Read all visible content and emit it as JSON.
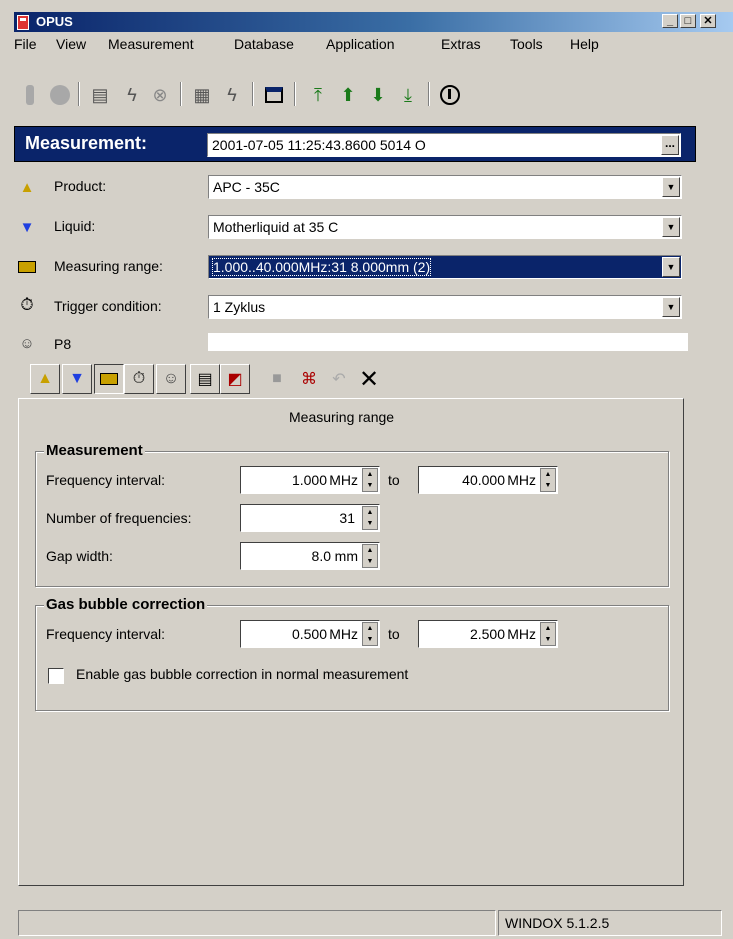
{
  "window": {
    "title": "OPUS"
  },
  "menu": [
    "File",
    "View",
    "Measurement",
    "Database",
    "Application",
    "Extras",
    "Tools",
    "Help"
  ],
  "measurement": {
    "label": "Measurement:",
    "value": "2001-07-05 11:25:43.8600 5014 O",
    "browse_label": "..."
  },
  "properties": {
    "product": {
      "label": "Product:",
      "value": "APC - 35C"
    },
    "liquid": {
      "label": "Liquid:",
      "value": "Motherliquid at 35 C"
    },
    "measuring_range": {
      "label": "Measuring range:",
      "value": "1.000..40.000MHz:31 8.000mm (2)"
    },
    "trigger": {
      "label": "Trigger condition:",
      "value": "1 Zyklus"
    },
    "p8": {
      "label": "P8",
      "value": ""
    }
  },
  "panel": {
    "title": "Measuring range",
    "measurement_group": {
      "title": "Measurement",
      "freq_label": "Frequency interval:",
      "freq_from": "1.000",
      "freq_to": "40.000",
      "unit_mhz": "MHz",
      "to_label": "to",
      "count_label": "Number of frequencies:",
      "count_value": "31",
      "gap_label": "Gap width:",
      "gap_value": "8.0",
      "unit_mm": "mm"
    },
    "gas_group": {
      "title": "Gas bubble correction",
      "freq_label": "Frequency interval:",
      "freq_from": "0.500",
      "freq_to": "2.500",
      "enable_label": "Enable gas bubble correction in normal measurement",
      "enable_checked": false
    }
  },
  "status": {
    "version": "WINDOX 5.1.2.5"
  },
  "colors": {
    "title_bar": "#0a246a",
    "selection": "#0a246a",
    "face": "#d4d0c8"
  }
}
